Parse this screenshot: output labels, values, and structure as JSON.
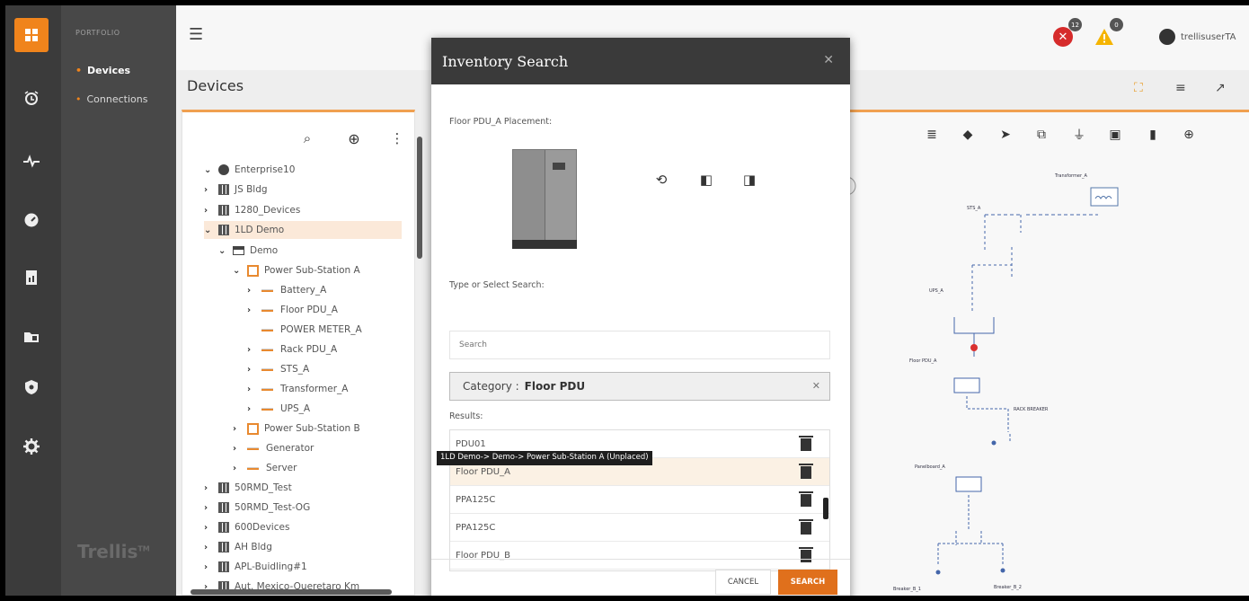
{
  "nav": {
    "section_label": "PORTFOLIO",
    "items": [
      "Devices",
      "Connections"
    ],
    "brand": "Trellis",
    "trademark": "TM"
  },
  "header": {
    "page_title": "Devices",
    "error_count": "12",
    "warning_count": "0",
    "username": "trellisuserTA"
  },
  "tree": {
    "rows": [
      {
        "label": "Enterprise10"
      },
      {
        "label": "JS Bldg"
      },
      {
        "label": "1280_Devices"
      },
      {
        "label": "1LD Demo"
      },
      {
        "label": "Demo"
      },
      {
        "label": "Power Sub-Station A"
      },
      {
        "label": "Battery_A"
      },
      {
        "label": "Floor PDU_A"
      },
      {
        "label": "POWER METER_A"
      },
      {
        "label": "Rack PDU_A"
      },
      {
        "label": "STS_A"
      },
      {
        "label": "Transformer_A"
      },
      {
        "label": "UPS_A"
      },
      {
        "label": "Power Sub-Station B"
      },
      {
        "label": "Generator"
      },
      {
        "label": "Server"
      },
      {
        "label": "50RMD_Test"
      },
      {
        "label": "50RMD_Test-OG"
      },
      {
        "label": "600Devices"
      },
      {
        "label": "AH Bldg"
      },
      {
        "label": "APL-Buidling#1"
      },
      {
        "label": "Aut. Mexico-Queretaro Km"
      }
    ]
  },
  "modal": {
    "title": "Inventory Search",
    "placement_label": "Floor PDU_A Placement:",
    "type_label": "Type or Select Search:",
    "search_placeholder": "Search",
    "category_prefix": "Category :",
    "category_value": "Floor PDU",
    "results_label": "Results:",
    "results": [
      "PDU01",
      "Floor PDU_A",
      "PPA125C",
      "PPA125C",
      "Floor PDU_B"
    ],
    "tooltip": "1LD Demo-> Demo-> Power Sub-Station A (Unplaced)",
    "cancel_label": "CANCEL",
    "search_label": "SEARCH"
  },
  "diagram": {
    "labels": [
      "Transformer_A",
      "STS_A",
      "UPS_A",
      "Floor PDU_A",
      "RACK BREAKER",
      "Panelboard_A",
      "Breaker_B_1",
      "Breaker_B_2"
    ]
  },
  "colors": {
    "accent": "#f0841c",
    "rail": "#3b3b3b",
    "nav": "#484848",
    "modal_header": "#3a3a3a",
    "error": "#d62b2b",
    "warning": "#f5b400"
  }
}
